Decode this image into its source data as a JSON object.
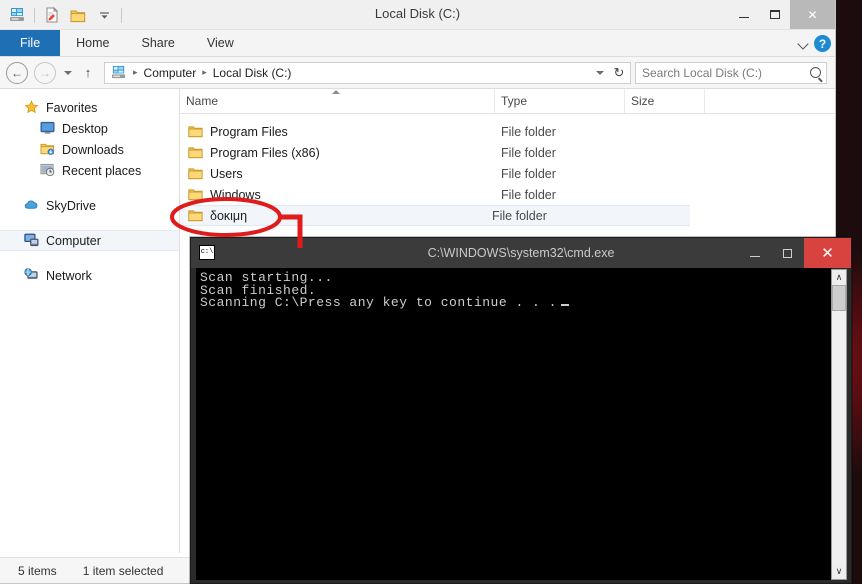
{
  "explorer": {
    "title": "Local Disk (C:)",
    "quick_access": [
      {
        "name": "drive-icon",
        "label": "Local Disk"
      },
      {
        "name": "properties-icon",
        "label": "Properties"
      },
      {
        "name": "new-folder-icon",
        "label": "New folder"
      },
      {
        "name": "customize-dropdown-icon",
        "label": "Customize Quick Access Toolbar"
      }
    ],
    "caption": {
      "minimize": "—",
      "maximize": "□",
      "close": "✕"
    },
    "ribbon": {
      "tabs": [
        {
          "label": "File",
          "active": true
        },
        {
          "label": "Home",
          "active": false
        },
        {
          "label": "Share",
          "active": false
        },
        {
          "label": "View",
          "active": false
        }
      ],
      "expand_label": "Expand the Ribbon",
      "help_label": "?"
    },
    "address": {
      "back_glyph": "←",
      "forward_glyph": "→",
      "up_glyph": "↑",
      "crumbs": [
        "Computer",
        "Local Disk (C:)"
      ],
      "separator": "▸",
      "refresh_glyph": "↻"
    },
    "search": {
      "placeholder": "Search Local Disk (C:)",
      "value": ""
    },
    "sidebar": {
      "groups": [
        {
          "items": [
            {
              "label": "Favorites",
              "icon": "star-icon",
              "level": 0,
              "selected": false
            },
            {
              "label": "Desktop",
              "icon": "desktop-icon",
              "level": 1,
              "selected": false
            },
            {
              "label": "Downloads",
              "icon": "downloads-icon",
              "level": 1,
              "selected": false
            },
            {
              "label": "Recent places",
              "icon": "recent-places-icon",
              "level": 1,
              "selected": false
            }
          ]
        },
        {
          "items": [
            {
              "label": "SkyDrive",
              "icon": "skydrive-icon",
              "level": 0,
              "selected": false
            }
          ]
        },
        {
          "items": [
            {
              "label": "Computer",
              "icon": "computer-icon",
              "level": 0,
              "selected": true
            }
          ]
        },
        {
          "items": [
            {
              "label": "Network",
              "icon": "network-icon",
              "level": 0,
              "selected": false
            }
          ]
        }
      ]
    },
    "list": {
      "columns": [
        {
          "label": "Name",
          "sorted": "asc"
        },
        {
          "label": "Type",
          "sorted": ""
        },
        {
          "label": "Size",
          "sorted": ""
        }
      ],
      "rows": [
        {
          "name": "Program Files",
          "type": "File folder",
          "size": "",
          "selected": false
        },
        {
          "name": "Program Files (x86)",
          "type": "File folder",
          "size": "",
          "selected": false
        },
        {
          "name": "Users",
          "type": "File folder",
          "size": "",
          "selected": false
        },
        {
          "name": "Windows",
          "type": "File folder",
          "size": "",
          "selected": false
        },
        {
          "name": "δοκιμη",
          "type": "File folder",
          "size": "",
          "selected": true
        }
      ]
    },
    "status": {
      "items_count": "5 items",
      "selection": "1 item selected"
    }
  },
  "cmd": {
    "title": "C:\\WINDOWS\\system32\\cmd.exe",
    "icon_text": "c:\\",
    "caption": {
      "minimize": "—",
      "maximize": "□",
      "close": "✕"
    },
    "lines": [
      "Scan starting...",
      "Scan finished.",
      "Scanning C:\\Press any key to continue . . ."
    ],
    "scrollbar": {
      "up": "∧",
      "down": "∨"
    }
  },
  "annotation": {
    "color": "#e01b1b",
    "shape": "ellipse-with-elbow-pointer",
    "target": "δοκιμη"
  }
}
